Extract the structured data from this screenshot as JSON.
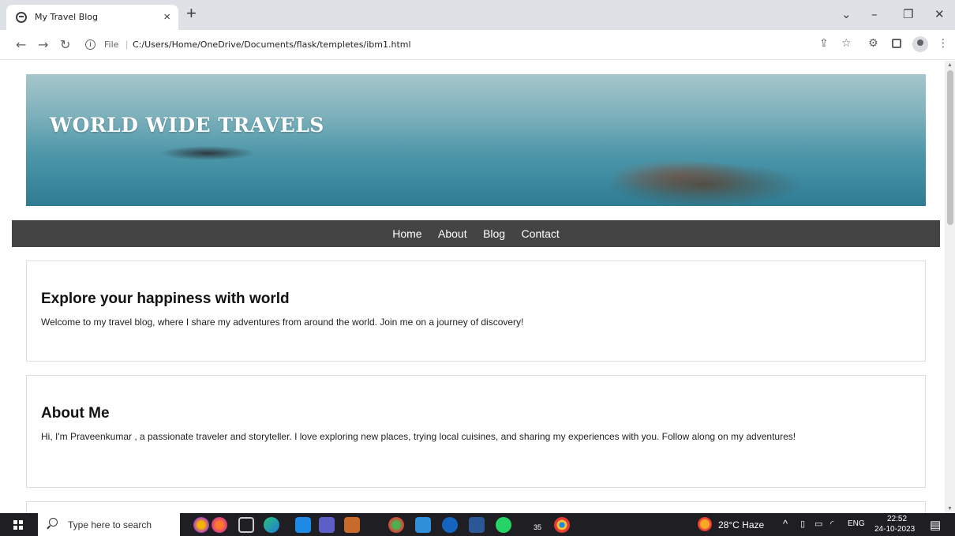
{
  "browser": {
    "tab_title": "My Travel Blog",
    "tab_close": "×",
    "new_tab": "+",
    "file_label": "File",
    "url": "C:/Users/Home/OneDrive/Documents/flask/templetes/ibm1.html"
  },
  "page": {
    "banner_title": "WORLD WIDE TRAVELS",
    "nav": [
      "Home",
      "About",
      "Blog",
      "Contact"
    ],
    "sections": [
      {
        "heading": "Explore your happiness with world",
        "text": "Welcome to my travel blog, where I share my adventures from around the world. Join me on a journey of discovery!"
      },
      {
        "heading": "About Me",
        "text": "Hi, I'm Praveenkumar , a passionate traveler and storyteller. I love exploring new places, trying local cuisines, and sharing my experiences with you. Follow along on my adventures!"
      }
    ]
  },
  "taskbar": {
    "search_placeholder": "Type here to search",
    "weather": "28°C  Haze",
    "language": "ENG",
    "time": "22:52",
    "date": "24-10-2023",
    "whatsapp_badge": "35"
  },
  "colors": {
    "navbar_bg": "#444444",
    "taskbar_bg": "#1f1f23",
    "tab_strip_bg": "#dee1e6"
  }
}
